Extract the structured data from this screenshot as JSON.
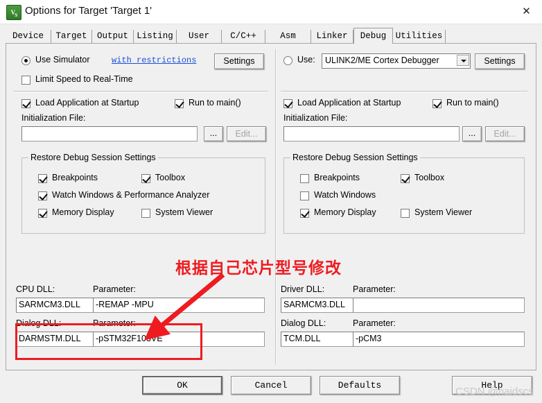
{
  "window": {
    "title": "Options for Target 'Target 1'",
    "icon": "uvision-logo-icon",
    "close_label": "✕"
  },
  "tabs": [
    {
      "label": "Device",
      "active": false
    },
    {
      "label": "Target",
      "active": false
    },
    {
      "label": "Output",
      "active": false
    },
    {
      "label": "Listing",
      "active": false
    },
    {
      "label": "User",
      "active": false
    },
    {
      "label": "C/C++",
      "active": false
    },
    {
      "label": "Asm",
      "active": false
    },
    {
      "label": "Linker",
      "active": false
    },
    {
      "label": "Debug",
      "active": true
    },
    {
      "label": "Utilities",
      "active": false
    }
  ],
  "left": {
    "use_simulator_label": "Use Simulator",
    "use_simulator_checked": true,
    "with_restrictions_link": "with restrictions",
    "settings_button": "Settings",
    "limit_speed_label": "Limit Speed to Real-Time",
    "limit_speed_checked": false,
    "load_app_label": "Load Application at Startup",
    "load_app_checked": true,
    "run_to_main_label": "Run to main()",
    "run_to_main_checked": true,
    "init_file_label": "Initialization File:",
    "init_file_value": "",
    "browse_button": "...",
    "edit_button": "Edit...",
    "restore_group_title": "Restore Debug Session Settings",
    "breakpoints_label": "Breakpoints",
    "breakpoints_checked": true,
    "toolbox_label": "Toolbox",
    "toolbox_checked": true,
    "watch_windows_label": "Watch Windows & Performance Analyzer",
    "watch_windows_checked": true,
    "memory_display_label": "Memory Display",
    "memory_display_checked": true,
    "system_viewer_label": "System Viewer",
    "system_viewer_checked": false,
    "cpu_dll_label": "CPU DLL:",
    "cpu_dll_value": "SARMCM3.DLL",
    "cpu_param_label": "Parameter:",
    "cpu_param_value": "-REMAP -MPU",
    "dialog_dll_label": "Dialog DLL:",
    "dialog_dll_value": "DARMSTM.DLL",
    "dialog_param_label": "Parameter:",
    "dialog_param_value": "-pSTM32F103VE"
  },
  "right": {
    "use_label": "Use:",
    "use_checked": false,
    "debugger_selected": "ULINK2/ME Cortex Debugger",
    "settings_button": "Settings",
    "load_app_label": "Load Application at Startup",
    "load_app_checked": true,
    "run_to_main_label": "Run to main()",
    "run_to_main_checked": true,
    "init_file_label": "Initialization File:",
    "init_file_value": "",
    "browse_button": "...",
    "edit_button": "Edit...",
    "restore_group_title": "Restore Debug Session Settings",
    "breakpoints_label": "Breakpoints",
    "breakpoints_checked": false,
    "toolbox_label": "Toolbox",
    "toolbox_checked": true,
    "watch_windows_label": "Watch Windows",
    "watch_windows_checked": false,
    "memory_display_label": "Memory Display",
    "memory_display_checked": true,
    "system_viewer_label": "System Viewer",
    "system_viewer_checked": false,
    "driver_dll_label": "Driver DLL:",
    "driver_dll_value": "SARMCM3.DLL",
    "driver_param_label": "Parameter:",
    "driver_param_value": "",
    "dialog_dll_label": "Dialog DLL:",
    "dialog_dll_value": "TCM.DLL",
    "dialog_param_label": "Parameter:",
    "dialog_param_value": "-pCM3"
  },
  "annotation": {
    "text": "根据自己芯片型号修改",
    "color": "#ee1c21"
  },
  "footer": {
    "ok": "OK",
    "cancel": "Cancel",
    "defaults": "Defaults",
    "help": "Help",
    "watermark": "CSDN @haidscs"
  }
}
